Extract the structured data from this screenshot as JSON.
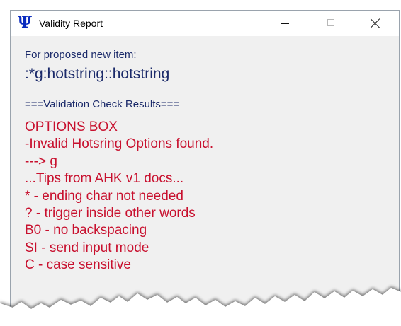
{
  "window": {
    "title": "Validity Report",
    "app_icon_glyph": "Ψ",
    "icon_color": "#0a2bbf",
    "controls": {
      "minimize": "minimize",
      "maximize": "maximize",
      "close": "close"
    }
  },
  "report": {
    "proposed_label": "For proposed new item:",
    "proposed_value": ":*g:hotstring::hotstring",
    "results_header": "===Validation Check Results===",
    "lines": [
      "OPTIONS BOX",
      "-Invalid Hotsring Options found.",
      "---> g",
      "...Tips from AHK v1 docs...",
      "* - ending char not needed",
      "? - trigger inside other words",
      "B0 - no backspacing",
      "SI - send input mode",
      "C - case sensitive"
    ]
  },
  "colors": {
    "label": "#1b2a6a",
    "error": "#c8102e",
    "window_bg": "#f0f0f0"
  }
}
